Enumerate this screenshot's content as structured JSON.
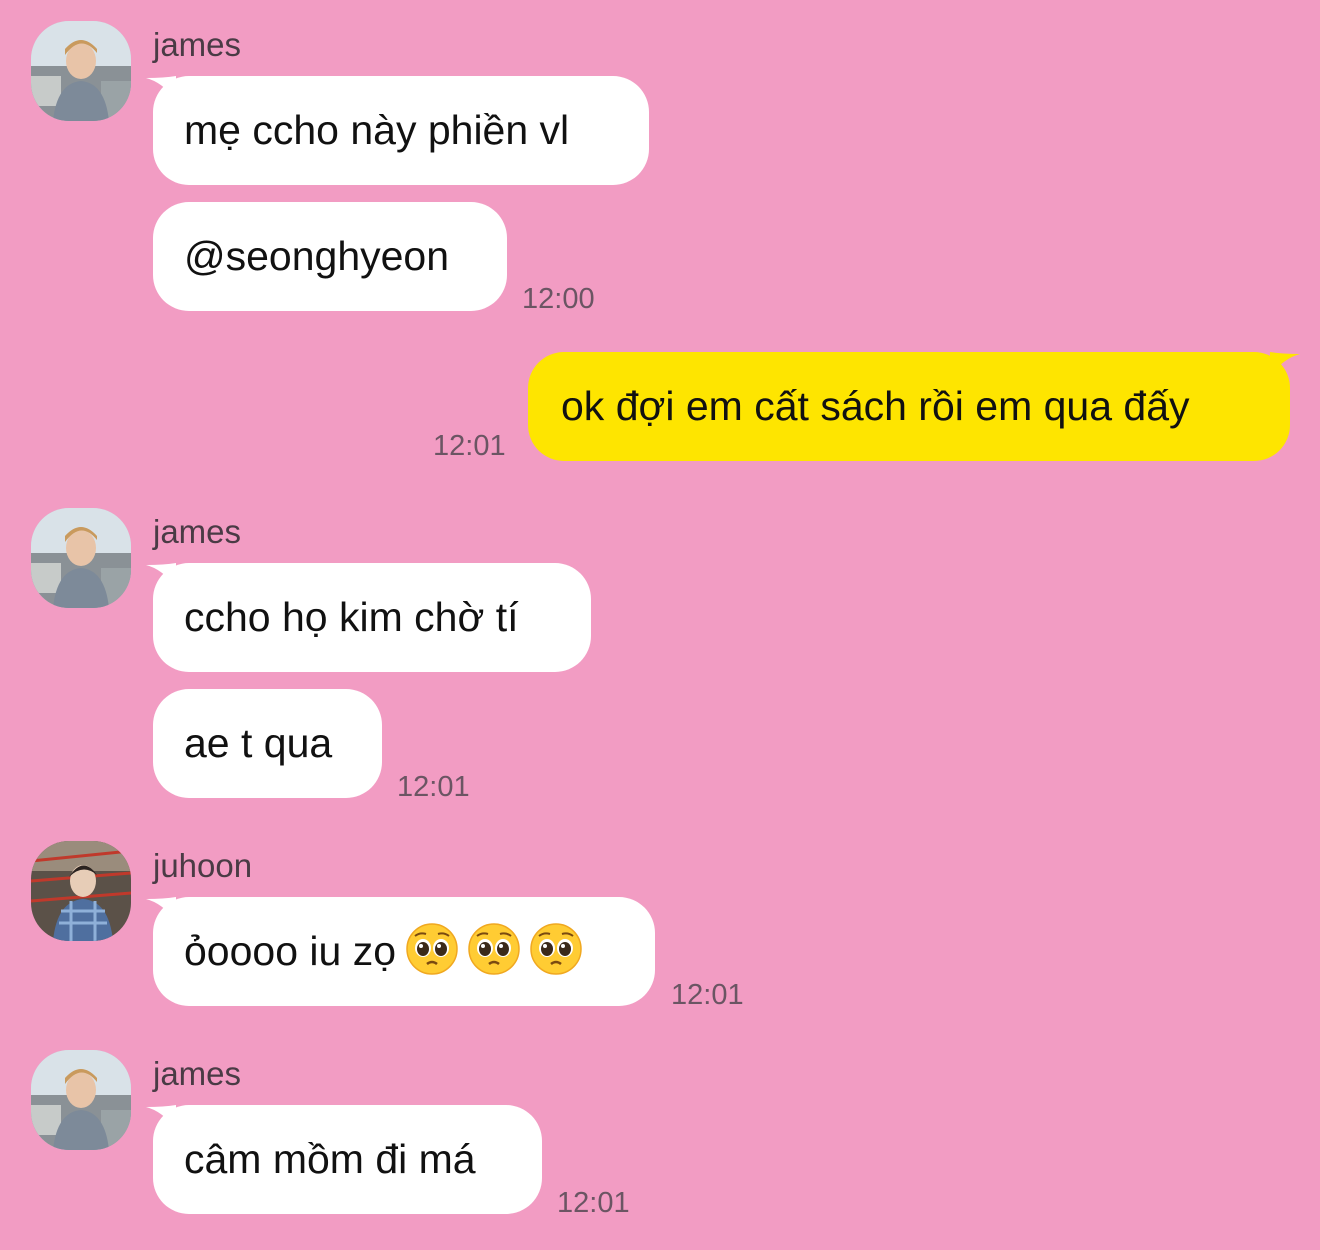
{
  "messages": [
    {
      "sender": "james",
      "bubbles": [
        "mẹ ccho này phiền vl",
        "@seonghyeon"
      ],
      "time": "12:00"
    },
    {
      "outgoing": true,
      "text": "ok đợi em cất sách rồi em qua đấy",
      "time": "12:01"
    },
    {
      "sender": "james",
      "bubbles": [
        "ccho họ kim chờ tí",
        "ae t qua"
      ],
      "time": "12:01"
    },
    {
      "sender": "juhoon",
      "text": "ỏoooo iu zọ",
      "emoji": [
        "pleading-face",
        "pleading-face",
        "pleading-face"
      ],
      "time": "12:01"
    },
    {
      "sender": "james",
      "bubbles": [
        "câm mồm đi má"
      ],
      "time": "12:01"
    }
  ],
  "colors": {
    "background": "#f29cc3",
    "incoming": "#ffffff",
    "outgoing": "#fee500"
  }
}
